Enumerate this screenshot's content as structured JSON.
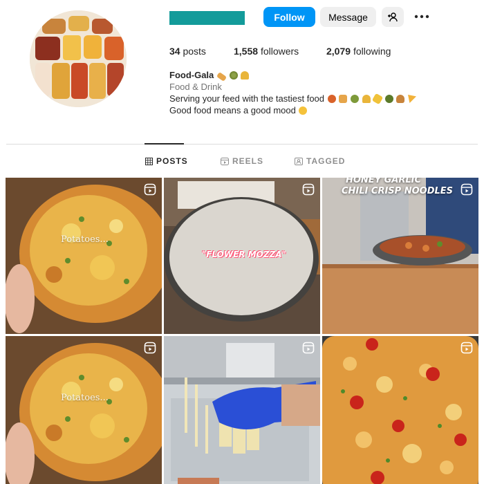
{
  "profile": {
    "username_redacted_color": "#139b9a",
    "follow_label": "Follow",
    "message_label": "Message",
    "stats": {
      "posts_count": "34",
      "posts_label": "posts",
      "followers_count": "1,558",
      "followers_label": "followers",
      "following_count": "2,079",
      "following_label": "following"
    },
    "bio": {
      "name": "Food-Gala",
      "category": "Food & Drink",
      "line1": "Serving your feed with the tastiest food",
      "line2": "Good food means a good mood"
    }
  },
  "tabs": [
    {
      "label": "POSTS",
      "icon": "grid-icon",
      "active": true
    },
    {
      "label": "REELS",
      "icon": "reels-icon",
      "active": false
    },
    {
      "label": "TAGGED",
      "icon": "tagged-icon",
      "active": false
    }
  ],
  "posts": [
    {
      "caption": "Potatoes...",
      "type": "reel"
    },
    {
      "caption": "\"FLOWER MOZZA\"",
      "type": "reel"
    },
    {
      "caption": "CHILI CRISP NOODLES",
      "caption_top": "HONEY GARLIC",
      "type": "reel"
    },
    {
      "caption": "Potatoes...",
      "type": "reel"
    },
    {
      "caption": "",
      "type": "reel"
    },
    {
      "caption": "",
      "type": "reel"
    }
  ],
  "colors": {
    "accent": "#0095f6",
    "secondary_button": "#efefef",
    "divider": "#dbdbdb",
    "muted_text": "#737373"
  }
}
